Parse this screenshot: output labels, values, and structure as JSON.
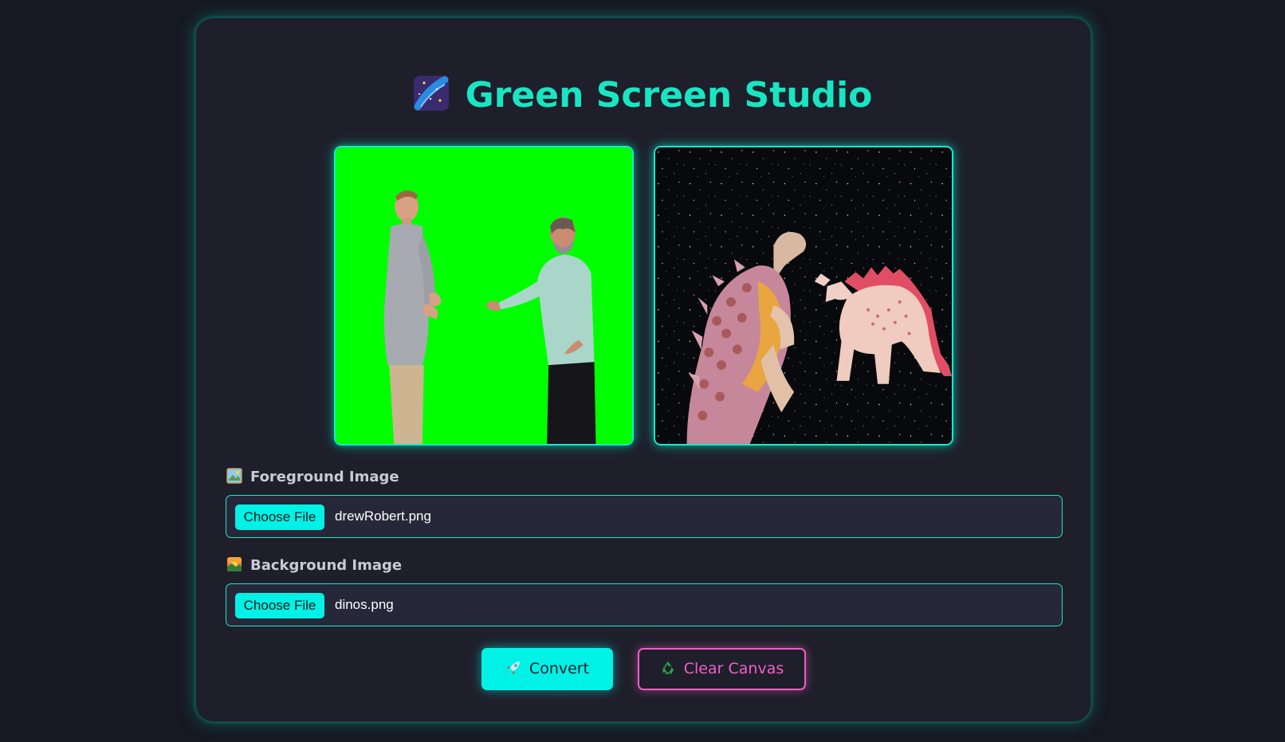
{
  "app": {
    "title": "Green Screen Studio",
    "title_icon": "milky-way-icon",
    "accent_color": "#18e6c2",
    "pink_color": "#f25fc8"
  },
  "canvases": {
    "foreground": {
      "description_icon": "green-screen-photo"
    },
    "background": {
      "description_icon": "dinosaurs-photo"
    }
  },
  "foreground_field": {
    "label": "Foreground Image",
    "icon": "framed-picture-icon",
    "button_label": "Choose File",
    "file_name": "drewRobert.png"
  },
  "background_field": {
    "label": "Background Image",
    "icon": "sunset-icon",
    "button_label": "Choose File",
    "file_name": "dinos.png"
  },
  "actions": {
    "convert_label": "Convert",
    "convert_icon": "rocket-icon",
    "clear_label": "Clear Canvas",
    "clear_icon": "recycle-icon"
  }
}
